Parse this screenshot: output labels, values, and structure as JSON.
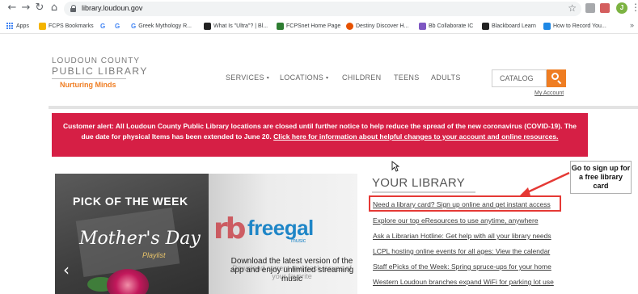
{
  "browser": {
    "url": "library.loudoun.gov",
    "bookmarks": [
      {
        "label": "Apps",
        "icon": "apps-grid-icon",
        "color": "#4285f4"
      },
      {
        "label": "FCPS Bookmarks",
        "icon": "folder-icon",
        "color": "#f4b400"
      },
      {
        "label": "G",
        "icon": "google-icon",
        "color": "#4285f4"
      },
      {
        "label": "G",
        "icon": "google-icon",
        "color": "#4285f4"
      },
      {
        "label": "Greek Mythology R...",
        "icon": "google-icon",
        "color": "#4285f4"
      },
      {
        "label": "What Is \"Ultra\"? | Bl...",
        "icon": "blackboard-icon",
        "color": "#222222"
      },
      {
        "label": "FCPSnet Home Page",
        "icon": "fcps-icon",
        "color": "#2e7d32"
      },
      {
        "label": "Destiny Discover H...",
        "icon": "destiny-icon",
        "color": "#e65100"
      },
      {
        "label": "Bb Collaborate IC",
        "icon": "collaborate-icon",
        "color": "#7e57c2"
      },
      {
        "label": "Blackboard Learn",
        "icon": "blackboard-icon",
        "color": "#222222"
      },
      {
        "label": "How to Record You...",
        "icon": "video-icon",
        "color": "#1e88e5"
      }
    ],
    "more": "»",
    "profile_initial": "J"
  },
  "site": {
    "logo": {
      "line1": "LOUDOUN COUNTY",
      "line2": "PUBLIC LIBRARY",
      "tagline": "Nurturing Minds"
    },
    "nav": [
      {
        "label": "SERVICES",
        "dropdown": true
      },
      {
        "label": "LOCATIONS",
        "dropdown": true
      },
      {
        "label": "CHILDREN",
        "dropdown": false
      },
      {
        "label": "TEENS",
        "dropdown": false
      },
      {
        "label": "ADULTS",
        "dropdown": false
      }
    ],
    "caret": "▾",
    "search_label": "CATALOG",
    "my_account": "My Account",
    "accent_color": "#ef7d22"
  },
  "alert": {
    "text": "Customer alert: All Loudoun County Public Library locations are closed until further notice to help reduce the spread of the new coronavirus (COVID-19). The due date for physical Items has been extended to June 20.",
    "link": "Click here for information about helpful changes to your account and online resources.",
    "color": "#d61f45"
  },
  "carousel": {
    "pick": "PICK OF THE WEEK",
    "title": "Mother's Day",
    "subtitle": "Playlist",
    "brand_mark": "rb",
    "brand": "freegal",
    "brand_sub": "music",
    "download_text": "Download the latest version of the app and enjoy unlimited streaming music",
    "ghost_text": "Download current and back issues of your favorite",
    "prev": "‹"
  },
  "your_library": {
    "title": "YOUR LIBRARY",
    "links": [
      "Need a library card? Sign up online and get instant access",
      "Explore our top eResources to use anytime, anywhere",
      "Ask a Librarian Hotline: Get help with all your library needs",
      "LCPL hosting online events for all ages: View the calendar",
      "Staff ePicks of the Week: Spring spruce-ups for your home",
      "Western Loudoun branches expand WiFi for parking lot use"
    ]
  },
  "callout": {
    "text": "Go to sign up for a free library card",
    "arrow_color": "#e53935"
  }
}
